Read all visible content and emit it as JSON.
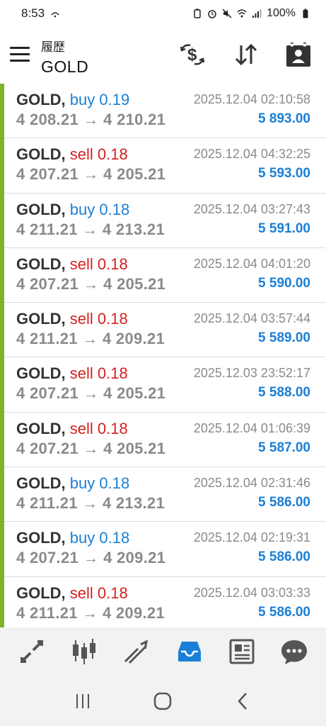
{
  "status": {
    "time": "8:53",
    "battery": "100%"
  },
  "header": {
    "subtitle": "履歴",
    "title": "GOLD"
  },
  "icons": {
    "menu": "hamburger-menu-icon",
    "currency": "currency-exchange-icon",
    "sort": "sort-arrows-icon",
    "calendar": "calendar-contact-icon"
  },
  "colors": {
    "accent_bar": "#7db42a",
    "buy": "#1a7fd6",
    "sell": "#d62020",
    "profit": "#1a7fd6",
    "active_tab": "#1a7fd6"
  },
  "deals": [
    {
      "symbol": "GOLD,",
      "side": "buy",
      "volume": "0.19",
      "side_label": "buy 0.19",
      "prices": "4 208.21 → 4 210.21",
      "time": "2025.12.04 02:10:58",
      "profit": "5 893.00"
    },
    {
      "symbol": "GOLD,",
      "side": "sell",
      "volume": "0.18",
      "side_label": "sell 0.18",
      "prices": "4 207.21 → 4 205.21",
      "time": "2025.12.04 04:32:25",
      "profit": "5 593.00"
    },
    {
      "symbol": "GOLD,",
      "side": "buy",
      "volume": "0.18",
      "side_label": "buy 0.18",
      "prices": "4 211.21 → 4 213.21",
      "time": "2025.12.04 03:27:43",
      "profit": "5 591.00"
    },
    {
      "symbol": "GOLD,",
      "side": "sell",
      "volume": "0.18",
      "side_label": "sell 0.18",
      "prices": "4 207.21 → 4 205.21",
      "time": "2025.12.04 04:01:20",
      "profit": "5 590.00"
    },
    {
      "symbol": "GOLD,",
      "side": "sell",
      "volume": "0.18",
      "side_label": "sell 0.18",
      "prices": "4 211.21 → 4 209.21",
      "time": "2025.12.04 03:57:44",
      "profit": "5 589.00"
    },
    {
      "symbol": "GOLD,",
      "side": "sell",
      "volume": "0.18",
      "side_label": "sell 0.18",
      "prices": "4 207.21 → 4 205.21",
      "time": "2025.12.03 23:52:17",
      "profit": "5 588.00"
    },
    {
      "symbol": "GOLD,",
      "side": "sell",
      "volume": "0.18",
      "side_label": "sell 0.18",
      "prices": "4 207.21 → 4 205.21",
      "time": "2025.12.04 01:06:39",
      "profit": "5 587.00"
    },
    {
      "symbol": "GOLD,",
      "side": "buy",
      "volume": "0.18",
      "side_label": "buy 0.18",
      "prices": "4 211.21 → 4 213.21",
      "time": "2025.12.04 02:31:46",
      "profit": "5 586.00"
    },
    {
      "symbol": "GOLD,",
      "side": "buy",
      "volume": "0.18",
      "side_label": "buy 0.18",
      "prices": "4 207.21 → 4 209.21",
      "time": "2025.12.04 02:19:31",
      "profit": "5 586.00"
    },
    {
      "symbol": "GOLD,",
      "side": "sell",
      "volume": "0.18",
      "side_label": "sell 0.18",
      "prices": "4 211.21 → 4 209.21",
      "time": "2025.12.04 03:03:33",
      "profit": "5 586.00"
    }
  ],
  "bottom_nav": [
    {
      "name": "quotes-icon",
      "active": false
    },
    {
      "name": "chart-candles-icon",
      "active": false
    },
    {
      "name": "trade-icon",
      "active": false
    },
    {
      "name": "history-inbox-icon",
      "active": true
    },
    {
      "name": "news-icon",
      "active": false
    },
    {
      "name": "chat-icon",
      "active": false
    }
  ],
  "system_nav": [
    "recent-apps-icon",
    "home-icon",
    "back-icon"
  ]
}
